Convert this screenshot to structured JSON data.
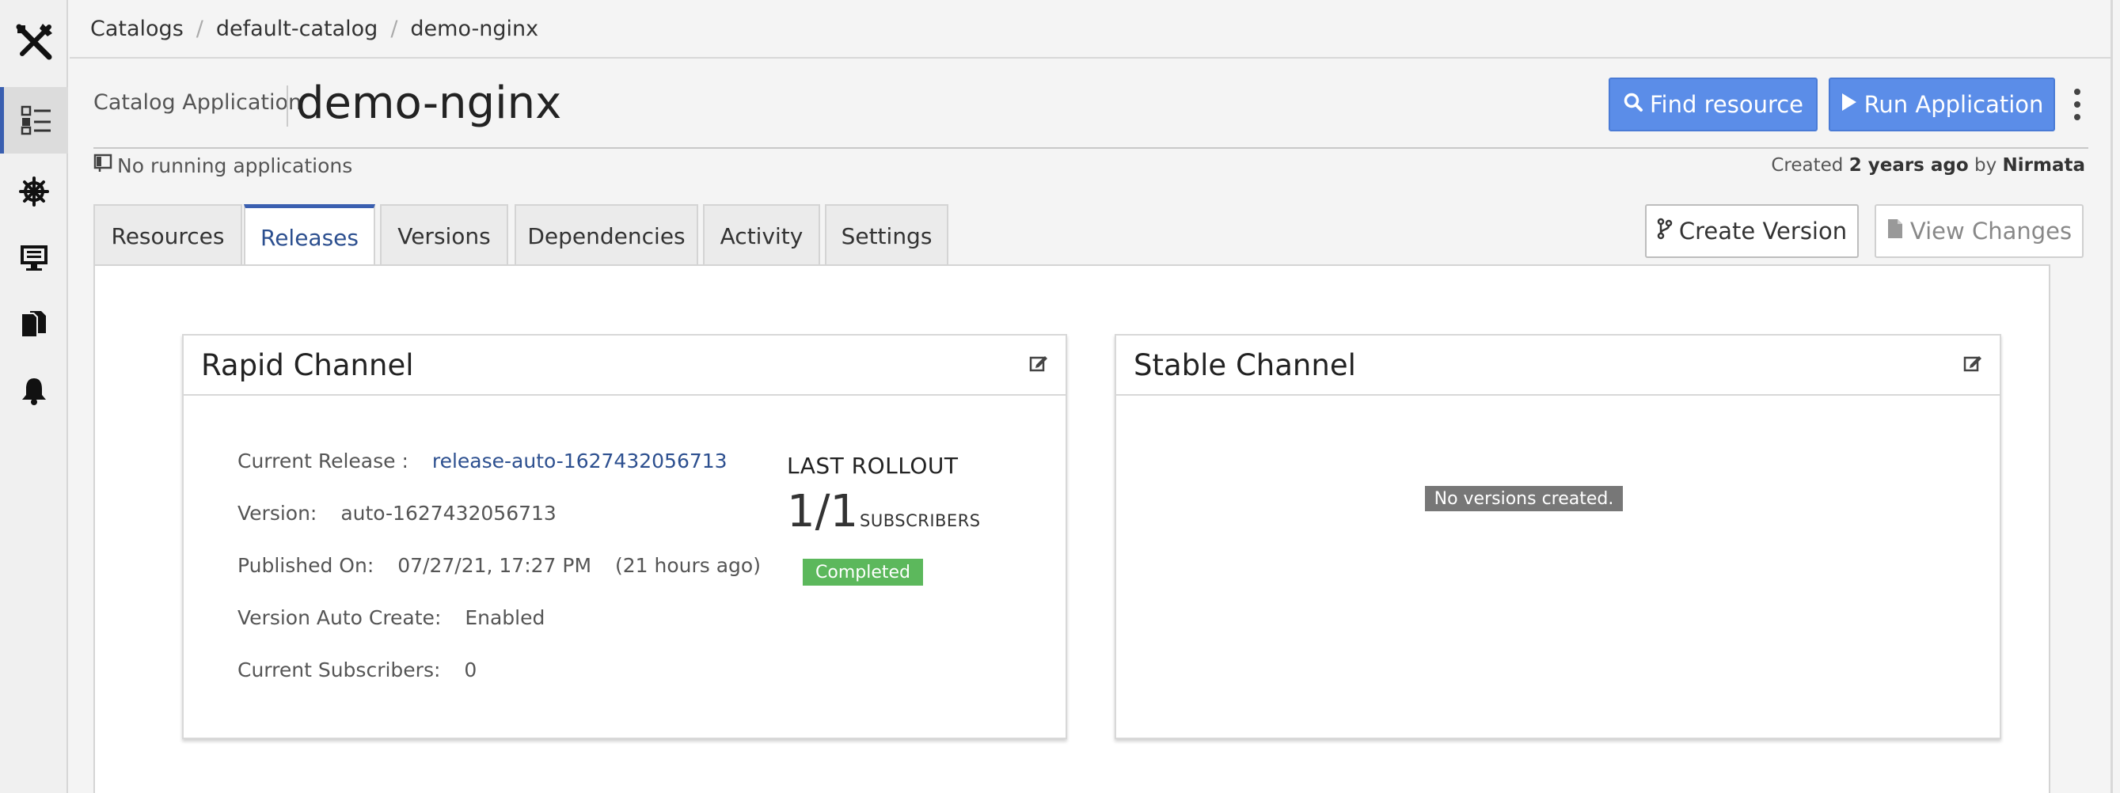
{
  "breadcrumb": [
    "Catalogs",
    "default-catalog",
    "demo-nginx"
  ],
  "header": {
    "app_type": "Catalog Application",
    "title": "demo-nginx",
    "find_label": "Find resource",
    "run_label": "Run Application",
    "status": "No running applications",
    "created_prefix": "Created",
    "created_age": "2 years ago",
    "created_by_word": "by",
    "created_by": "Nirmata"
  },
  "tabs": [
    {
      "label": "Resources",
      "active": false
    },
    {
      "label": "Releases",
      "active": true
    },
    {
      "label": "Versions",
      "active": false
    },
    {
      "label": "Dependencies",
      "active": false
    },
    {
      "label": "Activity",
      "active": false
    },
    {
      "label": "Settings",
      "active": false
    }
  ],
  "actions": {
    "create_version": "Create Version",
    "view_changes": "View Changes"
  },
  "rapid": {
    "title": "Rapid Channel",
    "current_release_label": "Current Release :",
    "current_release": "release-auto-1627432056713",
    "version_label": "Version:",
    "version": "auto-1627432056713",
    "published_label": "Published On:",
    "published": "07/27/21, 17:27 PM",
    "published_ago": "(21 hours ago)",
    "auto_create_label": "Version Auto Create:",
    "auto_create": "Enabled",
    "subscribers_label": "Current Subscribers:",
    "subscribers": "0",
    "rollout_label": "LAST ROLLOUT",
    "rollout_count": "1/1",
    "rollout_sub": "SUBSCRIBERS",
    "rollout_status": "Completed"
  },
  "stable": {
    "title": "Stable Channel",
    "empty": "No versions created."
  },
  "colors": {
    "accent": "#3a5fb0",
    "primary_button": "#5b8de8",
    "success": "#5cb85c",
    "link": "#2c4f8f"
  },
  "icons": [
    "tools-icon",
    "catalog-list-icon",
    "helm-wheel-icon",
    "monitor-icon",
    "documents-icon",
    "bell-icon",
    "search-icon",
    "play-icon",
    "branch-icon",
    "file-icon",
    "edit-icon"
  ]
}
